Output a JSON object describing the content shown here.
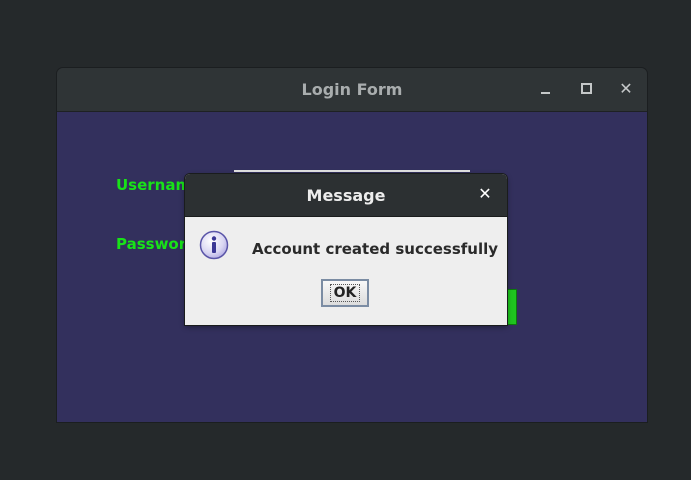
{
  "window": {
    "title": "Login Form",
    "minimize_icon": "minimize-icon",
    "maximize_icon": "maximize-icon",
    "close_icon": "close-icon"
  },
  "form": {
    "username_label": "Usernam",
    "password_label": "Passwor",
    "label_color": "#18e318",
    "background_color": "#33305d"
  },
  "dialog": {
    "title": "Message",
    "close_glyph": "✕",
    "message": "Account created successfully",
    "ok_label": "OK",
    "icon": "info-icon"
  }
}
